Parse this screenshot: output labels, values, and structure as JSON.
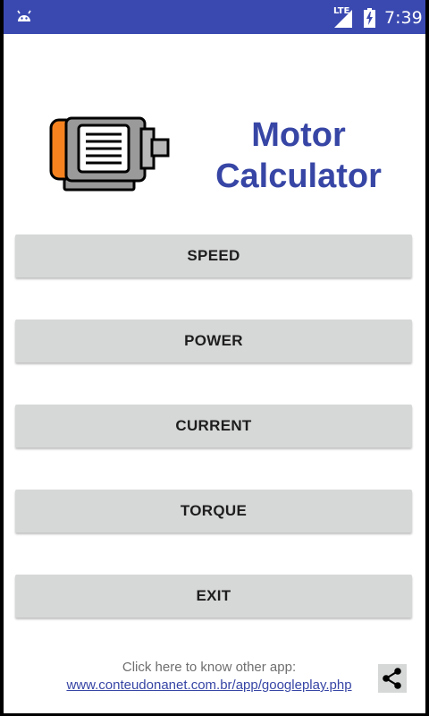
{
  "status_bar": {
    "network": "LTE",
    "time": "7:39"
  },
  "header": {
    "title_line1": "Motor",
    "title_line2": "Calculator"
  },
  "menu": {
    "buttons": [
      "SPEED",
      "POWER",
      "CURRENT",
      "TORQUE",
      "EXIT"
    ]
  },
  "footer": {
    "text": "Click here to know other app:",
    "link": "www.conteudonanet.com.br/app/googleplay.php"
  },
  "icons": {
    "status": [
      "android-icon",
      "signal-icon",
      "battery-charging-icon"
    ],
    "app": [
      "electric-motor-icon"
    ],
    "footer": [
      "share-icon"
    ]
  },
  "colors": {
    "status_bar": "#3a49b0",
    "title": "#3746a5",
    "button": "#d6d7d7",
    "motor_accent": "#f5821f"
  }
}
